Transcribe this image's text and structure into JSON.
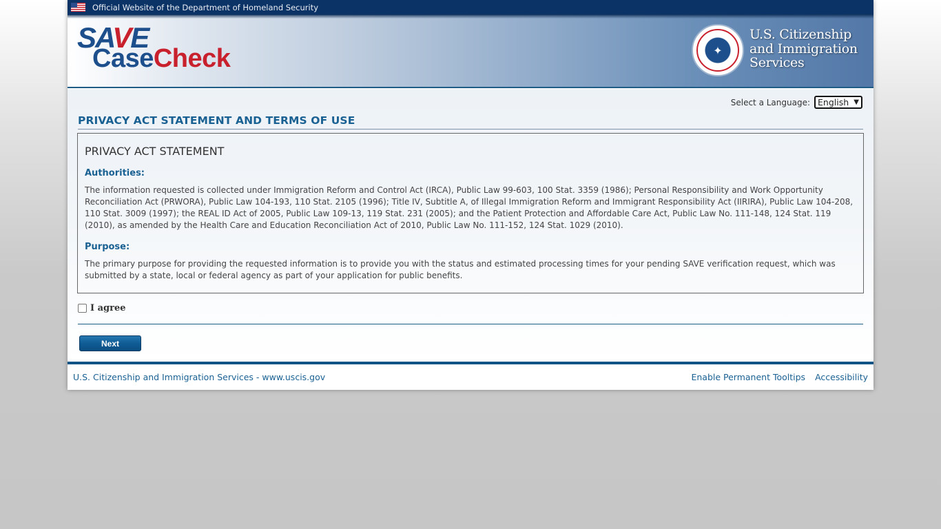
{
  "banner": {
    "flag_icon": "us-flag-icon",
    "text": "Official Website of the Department of Homeland Security"
  },
  "header": {
    "logo": {
      "save_s": "S",
      "save_a": "A",
      "save_v": "V",
      "save_e": "E",
      "case": "Case",
      "check": "Check"
    },
    "seal_icon": "dhs-seal-icon",
    "agency_line1": "U.S. Citizenship",
    "agency_line2": "and Immigration",
    "agency_line3": "Services"
  },
  "language": {
    "label": "Select a Language:",
    "selected": "English",
    "chevron": "⌄"
  },
  "main": {
    "title": "PRIVACY ACT STATEMENT AND TERMS OF USE",
    "statement_heading": "PRIVACY ACT STATEMENT",
    "sections": [
      {
        "heading": "Authorities:",
        "body": "The information requested is collected under Immigration Reform and Control Act (IRCA), Public Law 99-603, 100 Stat. 3359 (1986); Personal Responsibility and Work Opportunity Reconciliation Act (PRWORA), Public Law 104-193, 110 Stat. 2105 (1996); Title IV, Subtitle A, of Illegal Immigration Reform and Immigrant Responsibility Act (IIRIRA), Public Law 104-208, 110 Stat. 3009 (1997); the REAL ID Act of 2005, Public Law 109-13, 119 Stat. 231 (2005); and the Patient Protection and Affordable Care Act, Public Law No. 111-148, 124 Stat. 119 (2010), as amended by the Health Care and Education Reconciliation Act of 2010, Public Law No. 111-152, 124 Stat. 1029 (2010)."
      },
      {
        "heading": "Purpose:",
        "body": "The primary purpose for providing the requested information is to provide you with the status and estimated processing times for your pending SAVE verification request, which was submitted by a state, local or federal agency as part of your application for public benefits."
      }
    ],
    "agree_label": "I agree",
    "agree_checked": false,
    "next_label": "Next"
  },
  "footer": {
    "left_link": "U.S. Citizenship and Immigration Services - www.uscis.gov",
    "tooltips_link": "Enable Permanent Tooltips",
    "accessibility_link": "Accessibility"
  },
  "colors": {
    "brand_blue": "#1a6193",
    "banner_navy": "#0c3366",
    "logo_red": "#c8202c",
    "logo_blue": "#1d4f8c",
    "button_blue": "#0f5c95"
  }
}
